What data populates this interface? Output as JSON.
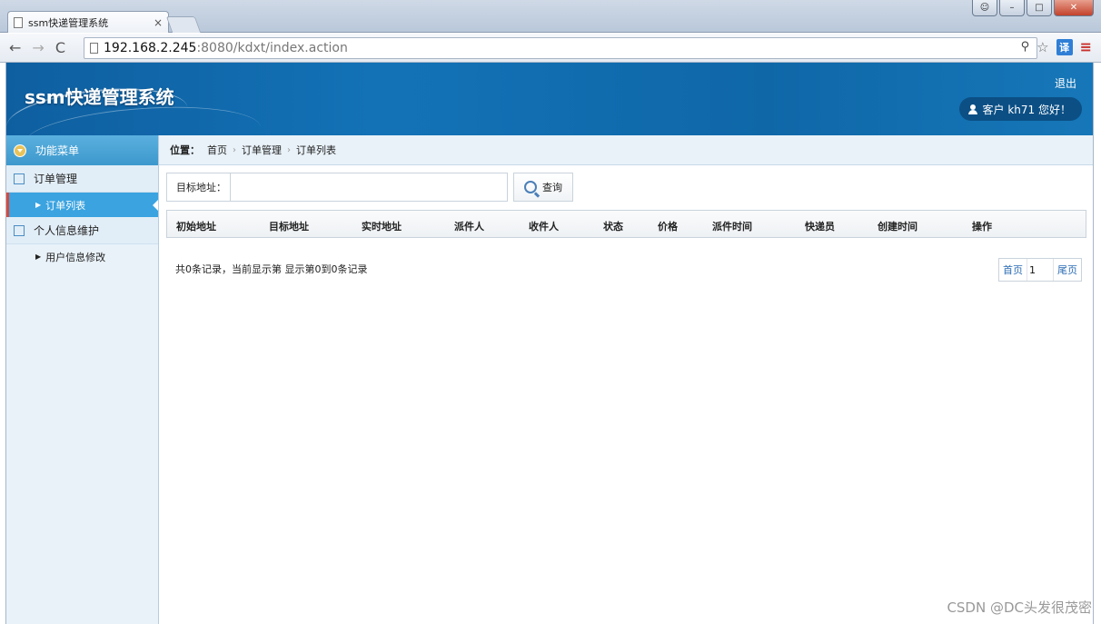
{
  "browser": {
    "tab_title": "ssm快递管理系统",
    "tab_close": "×",
    "url_host": "192.168.2.245",
    "url_rest": ":8080/kdxt/index.action",
    "translate_label": "译",
    "menu_glyph": "≡"
  },
  "header": {
    "brand": "ssm快递管理系统",
    "logout": "退出",
    "user_greeting": "客户  kh71 您好！"
  },
  "sidebar": {
    "title": "功能菜单",
    "groups": [
      {
        "label": "订单管理",
        "items": [
          {
            "label": "订单列表"
          }
        ]
      },
      {
        "label": "个人信息维护",
        "items": [
          {
            "label": "用户信息修改"
          }
        ]
      }
    ]
  },
  "breadcrumb": {
    "label": "位置：",
    "items": [
      "首页",
      "订单管理",
      "订单列表"
    ]
  },
  "search": {
    "label": "目标地址：",
    "value": "",
    "button": "查询"
  },
  "table": {
    "columns": [
      "初始地址",
      "目标地址",
      "实时地址",
      "派件人",
      "收件人",
      "状态",
      "价格",
      "派件时间",
      "快递员",
      "创建时间",
      "操作"
    ]
  },
  "pagination": {
    "summary": "共0条记录，当前显示第  显示第0到0条记录",
    "first": "首页",
    "page": "1",
    "last": "尾页"
  },
  "watermark": "CSDN @DC头发很茂密",
  "colors": {
    "header_blue": "#1372b6",
    "sidebar_active": "#3aa3e0",
    "active_marker": "#d9483b"
  }
}
